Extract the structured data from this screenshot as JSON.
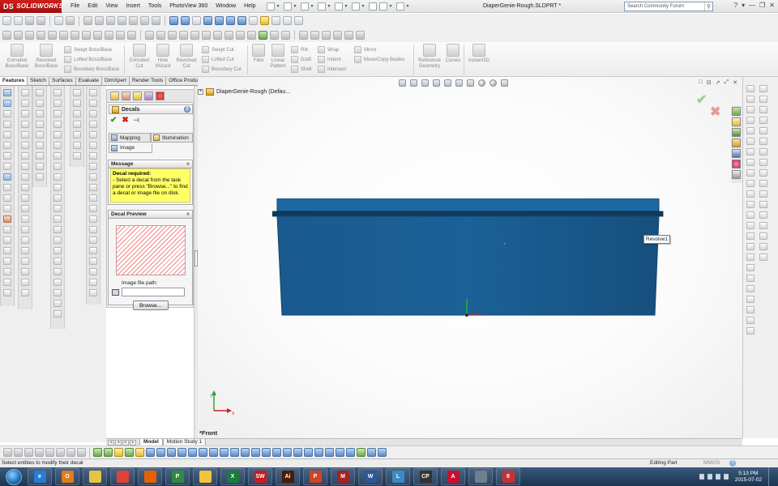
{
  "app": {
    "name": "SOLIDWORKS",
    "logo_mark": "DS"
  },
  "menu": [
    "File",
    "Edit",
    "View",
    "Insert",
    "Tools",
    "PhotoView 360",
    "Window",
    "Help"
  ],
  "document_title": "DiaperGenie-Rough.SLDPRT *",
  "search": {
    "placeholder": "Search Community Forum"
  },
  "command_manager": {
    "extruded_boss": "Extruded\nBoss/Base",
    "revolved_boss": "Revolved\nBoss/Base",
    "swept_boss": "Swept Boss/Base",
    "lofted_boss": "Lofted Boss/Base",
    "boundary_boss": "Boundary Boss/Base",
    "extruded_cut": "Extruded\nCut",
    "hole_wizard": "Hole\nWizard",
    "revolved_cut": "Revolved\nCut",
    "swept_cut": "Swept Cut",
    "lofted_cut": "Lofted Cut",
    "boundary_cut": "Boundary Cut",
    "fillet": "Fillet",
    "linear_pattern": "Linear\nPattern",
    "rib": "Rib",
    "draft": "Draft",
    "shell": "Shell",
    "wrap": "Wrap",
    "indent": "Indent",
    "intersect": "Intersect",
    "mirror": "Mirror",
    "move_copy": "Move/Copy Bodies",
    "ref_geometry": "Reference\nGeometry",
    "curves": "Curves",
    "instant3d": "Instant3D"
  },
  "tabs": [
    "Features",
    "Sketch",
    "Surfaces",
    "Evaluate",
    "DimXpert",
    "Render Tools",
    "Office Products"
  ],
  "active_tab": "Features",
  "property_manager": {
    "title": "Decals",
    "help": "?",
    "ok": "✔",
    "cancel": "✖",
    "pin": "⊣",
    "tab_mapping": "Mapping",
    "tab_illumination": "Illumination",
    "tab_image": "Image",
    "message_header": "Message",
    "message_title": "Decal required:",
    "message_text": "- Select a decal from the task pane or press \"Browse...\" to find a decal or image file on disk.",
    "collapse": "«",
    "preview_header": "Decal Preview",
    "image_path_label": "Image file path:",
    "image_path_value": "",
    "browse": "Browse..."
  },
  "tree": {
    "expander": "+",
    "root": "DiaperGenie-Rough (Defau..."
  },
  "graphics": {
    "tooltip": "Revolve1",
    "view_name": "*Front",
    "part_color": "#1a6197",
    "part_edge_color": "#14466f",
    "confirm_ok": "✔",
    "confirm_cancel": "✖",
    "window_controls": [
      "□",
      "⊟",
      "↗",
      "⤢",
      "✕"
    ],
    "triad": {
      "y": "Y",
      "x": "X"
    }
  },
  "bottom_tabs": {
    "nav": [
      "◂",
      "◂",
      "▸",
      "▸"
    ],
    "model": "Model",
    "motion": "Motion Study 1"
  },
  "status": {
    "left": "Select entities to modify their decal",
    "mode": "Editing Part",
    "units": "MMGS",
    "help": "?"
  },
  "window_controls": [
    "?",
    "▾",
    "—",
    "❐",
    "✕"
  ],
  "taskbar": {
    "apps": [
      {
        "name": "ie-icon",
        "color": "#2a7bd4",
        "label": "e"
      },
      {
        "name": "outlook-icon",
        "color": "#e07b1b",
        "label": "O"
      },
      {
        "name": "explorer-icon",
        "color": "#e8c244",
        "label": ""
      },
      {
        "name": "chrome-icon",
        "color": "#db4437",
        "label": ""
      },
      {
        "name": "firefox-icon",
        "color": "#e66000",
        "label": ""
      },
      {
        "name": "publisher-icon",
        "color": "#2f8a3f",
        "label": "P"
      },
      {
        "name": "notes-icon",
        "color": "#f3c33b",
        "label": ""
      },
      {
        "name": "excel-icon",
        "color": "#1d7a3e",
        "label": "X"
      },
      {
        "name": "solidworks-icon",
        "color": "#c41e1e",
        "label": "SW"
      },
      {
        "name": "illustrator-icon",
        "color": "#4a1c06",
        "label": "Ai"
      },
      {
        "name": "powerpoint-icon",
        "color": "#d04423",
        "label": "P"
      },
      {
        "name": "mendeley-icon",
        "color": "#a4231f",
        "label": "M"
      },
      {
        "name": "word-icon",
        "color": "#2b579a",
        "label": "W"
      },
      {
        "name": "calendar-icon",
        "color": "#3b8cc4",
        "label": "L"
      },
      {
        "name": "cp-icon",
        "color": "#333333",
        "label": "CP"
      },
      {
        "name": "acrobat-icon",
        "color": "#c8102e",
        "label": "A"
      },
      {
        "name": "calculator-icon",
        "color": "#6f7f8f",
        "label": ""
      },
      {
        "name": "paint-icon",
        "color": "#c93131",
        "label": "8"
      }
    ],
    "time": "5:13 PM",
    "date": "2015-07-02"
  }
}
